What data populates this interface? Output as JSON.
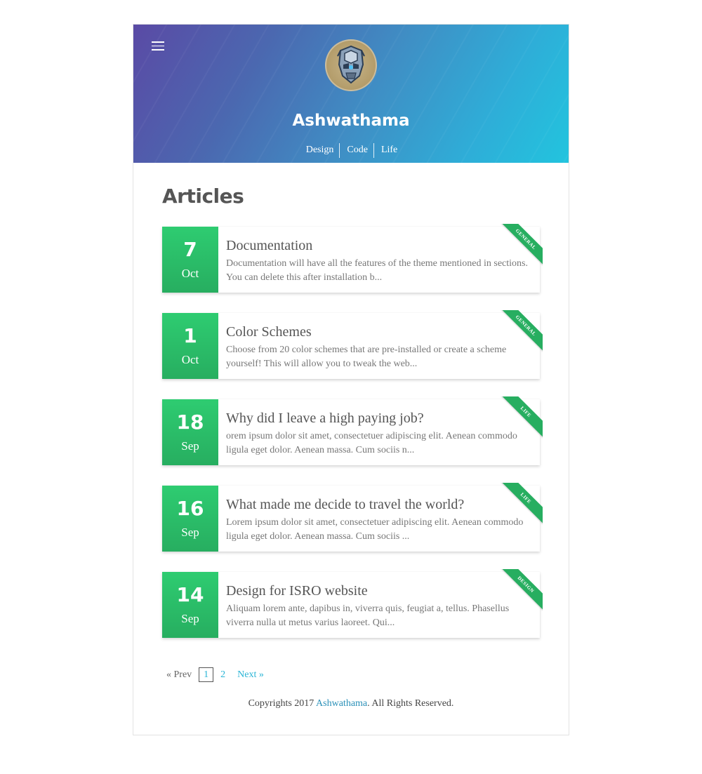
{
  "header": {
    "title": "Ashwathama",
    "nav": [
      "Design",
      "Code",
      "Life"
    ],
    "avatar_icon": "robot-avatar-icon",
    "menu_icon": "hamburger-menu-icon"
  },
  "main": {
    "heading": "Articles",
    "articles": [
      {
        "day": "7",
        "month": "Oct",
        "title": "Documentation",
        "excerpt": "Documentation will have all the features of the theme mentioned in sections. You can delete this after installation b...",
        "tag": "GENERAL"
      },
      {
        "day": "1",
        "month": "Oct",
        "title": "Color Schemes",
        "excerpt": "Choose from 20 color schemes that are pre-installed or create a scheme yourself! This will allow you to tweak the web...",
        "tag": "GENERAL"
      },
      {
        "day": "18",
        "month": "Sep",
        "title": "Why did I leave a high paying job?",
        "excerpt": "orem ipsum dolor sit amet, consectetuer adipiscing elit. Aenean commodo ligula eget dolor. Aenean massa. Cum sociis n...",
        "tag": "LIFE"
      },
      {
        "day": "16",
        "month": "Sep",
        "title": "What made me decide to travel the world?",
        "excerpt": "Lorem ipsum dolor sit amet, consectetuer adipiscing elit. Aenean commodo ligula eget dolor. Aenean massa. Cum sociis ...",
        "tag": "LIFE"
      },
      {
        "day": "14",
        "month": "Sep",
        "title": "Design for ISRO website",
        "excerpt": "Aliquam lorem ante, dapibus in, viverra quis, feugiat a, tellus. Phasellus viverra nulla ut metus varius laoreet. Qui...",
        "tag": "DESIGN"
      }
    ]
  },
  "pagination": {
    "prev": "« Prev",
    "pages": [
      "1",
      "2"
    ],
    "next": "Next »"
  },
  "footer": {
    "prefix": "Copyrights 2017 ",
    "link": "Ashwathama",
    "suffix": ". All Rights Reserved."
  },
  "colors": {
    "date_green": "#2ecc71",
    "ribbon_green": "#27ae60",
    "link_blue": "#2bb5d6",
    "header_start": "#5a4aa5",
    "header_end": "#22c4de"
  }
}
